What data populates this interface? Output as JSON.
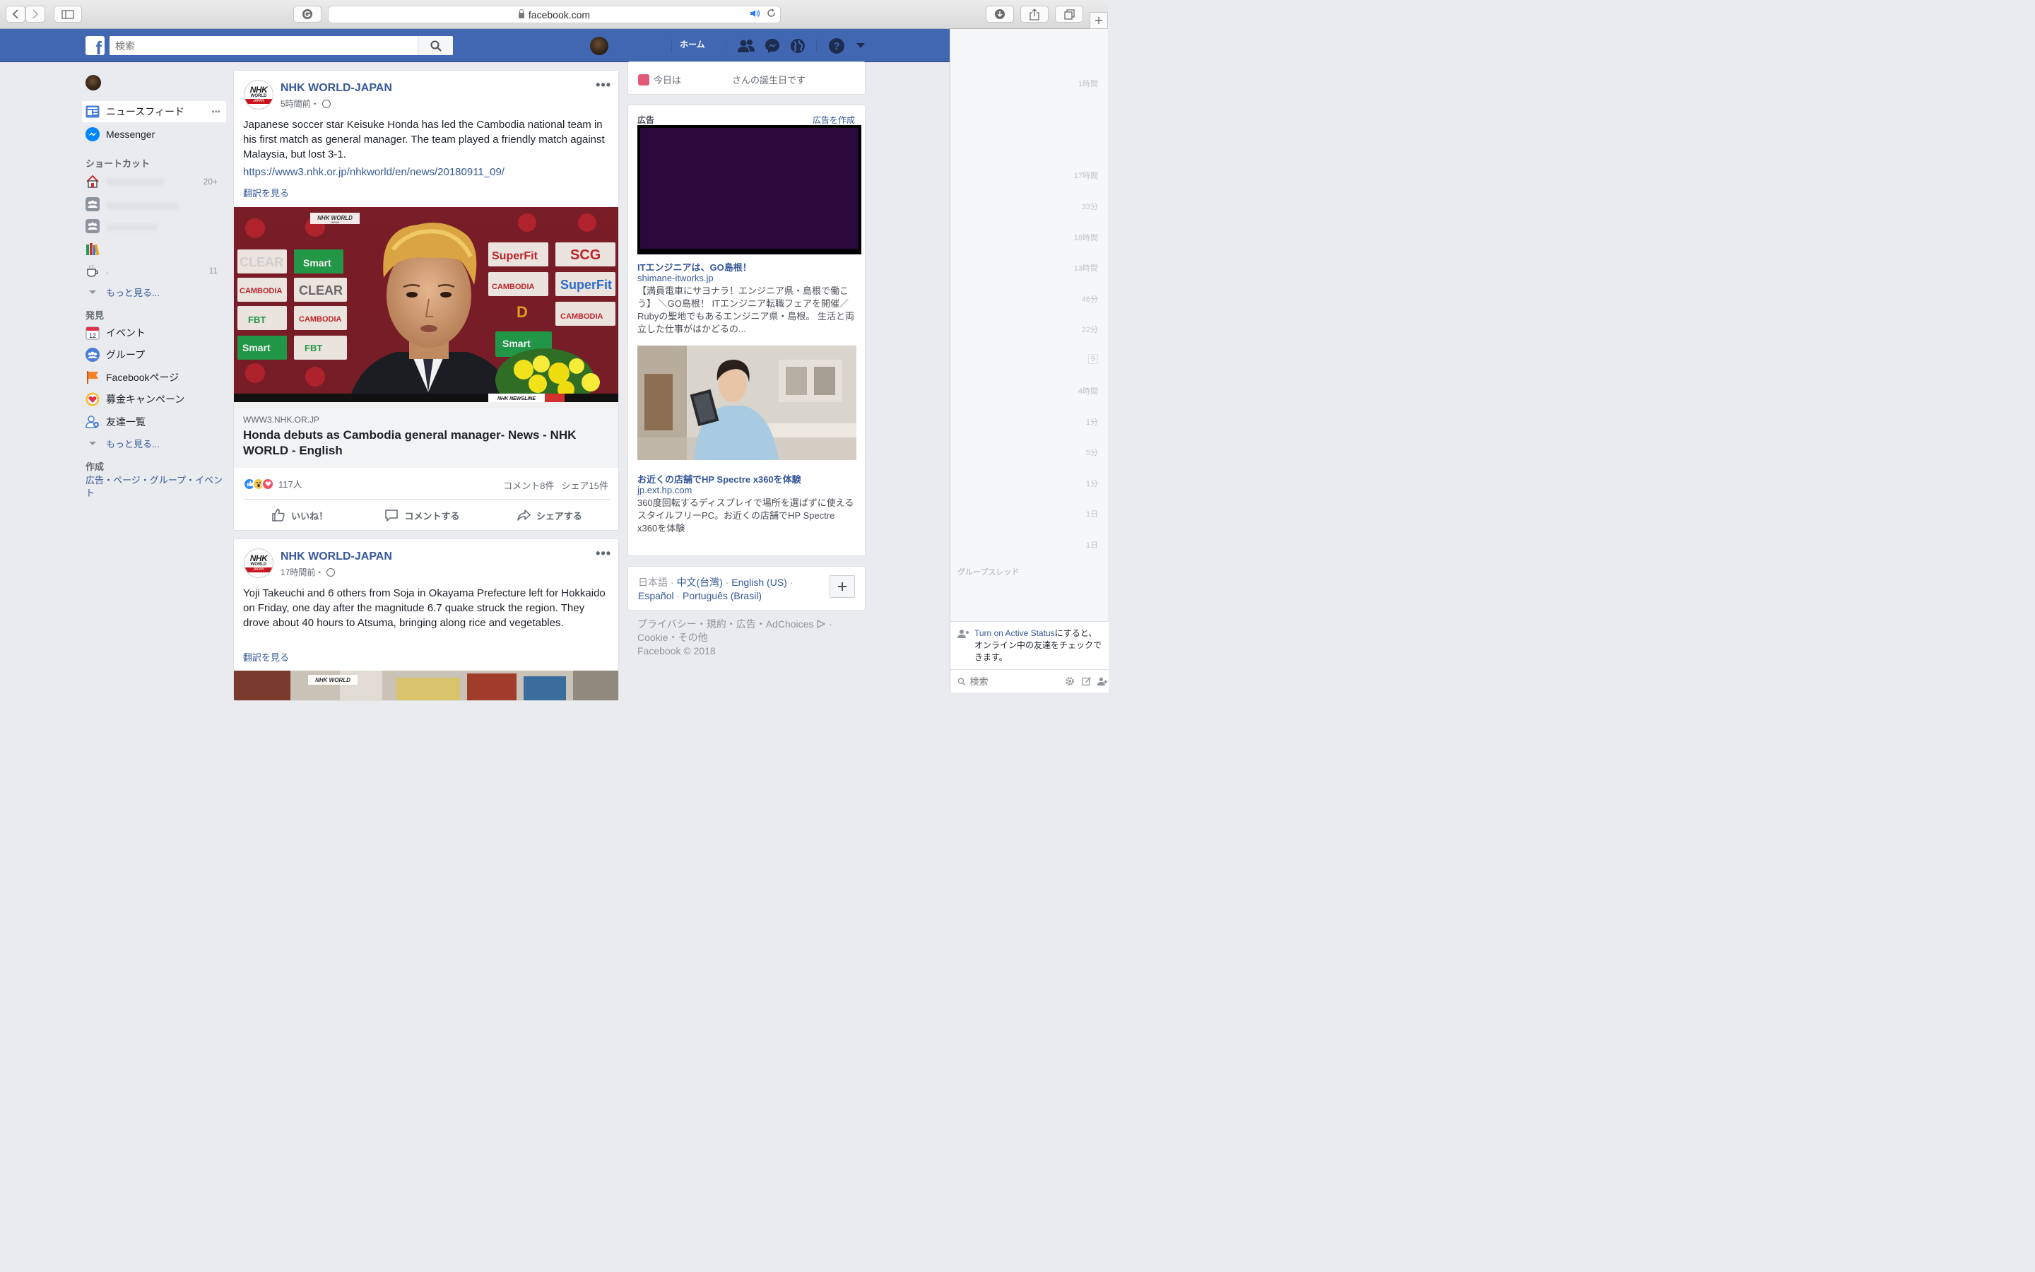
{
  "browser": {
    "url": "facebook.com"
  },
  "header": {
    "search_placeholder": "検索",
    "home_label": "ホーム"
  },
  "sidebar": {
    "news_feed": "ニュースフィード",
    "news_feed_more": "•••",
    "messenger": "Messenger",
    "shortcuts_title": "ショートカット",
    "shortcut_counts": [
      "20+",
      "11"
    ],
    "shortcut_dot": ".",
    "see_more_1": "もっと見る...",
    "explore_title": "発見",
    "explore_items": [
      "イベント",
      "グループ",
      "Facebookページ",
      "募金キャンペーン",
      "友達一覧"
    ],
    "calendar_day": "12",
    "see_more_2": "もっと見る...",
    "create_title": "作成",
    "create_links": "広告・ページ・グループ・イベント"
  },
  "posts": [
    {
      "page_name": "NHK WORLD-JAPAN",
      "time": "5時間前・",
      "text": "Japanese soccer star Keisuke Honda has led the Cambodia national team in his first match as general manager. The team played a friendly match against Malaysia, but lost 3-1.",
      "link": "https://www3.nhk.or.jp/nhkworld/en/news/20180911_09/",
      "translate": "翻訳を見る",
      "link_domain": "WWW3.NHK.OR.JP",
      "link_title": "Honda debuts as Cambodia general manager- News - NHK WORLD - English",
      "reactions_count": "117人",
      "comments": "コメント8件",
      "shares": "シェア15件",
      "actions": [
        "いいね！",
        "コメントする",
        "シェアする"
      ]
    },
    {
      "page_name": "NHK WORLD-JAPAN",
      "time": "17時間前・",
      "text": "Yoji Takeuchi and 6 others from Soja in Okayama Prefecture left for Hokkaido on Friday, one day after the magnitude 6.7 quake struck the region. They drove about 40 hours to Atsuma, bringing along rice and vegetables.",
      "translate": "翻訳を見る"
    }
  ],
  "photo_text": {
    "watermark": "NHK WORLD",
    "watermark_sub": "JAPAN",
    "ticker": "NHK NEWSLINE",
    "backdrop": [
      "CLEAR",
      "Smart",
      "SuperFit",
      "SCG",
      "CAMBODIA",
      "FBT",
      "D"
    ]
  },
  "page_avatar": {
    "line1": "NHK",
    "line2": "WORLD",
    "line3": "JAPAN"
  },
  "right": {
    "birthday_prefix": "今日は",
    "birthday_suffix": "さんの誕生日です",
    "ad_header": "広告",
    "ad_create": "広告を作成",
    "ads": [
      {
        "title": "ITエンジニアは、GO島根！",
        "url": "shimane-itworks.jp",
        "desc": "【満員電車にサヨナラ！エンジニア県・島根で働こう】 ＼GO島根！ ITエンジニア転職フェアを開催／ Rubyの聖地でもあるエンジニア県・島根。 生活と両立した仕事がはかどるの..."
      },
      {
        "title": "お近くの店舗でHP Spectre x360を体験",
        "url": "jp.ext.hp.com",
        "desc": "360度回転するディスプレイで場所を選ばずに使えるスタイルフリーPC。お近くの店舗でHP Spectre x360を体験"
      }
    ],
    "languages": {
      "current": "日本語",
      "others": [
        "中文(台灣)",
        "English (US)",
        "Español",
        "Português (Brasil)"
      ]
    },
    "footer_line1": "プライバシー・規約・広告・AdChoices",
    "footer_line2": "Cookie・その他",
    "copyright": "Facebook © 2018"
  },
  "chat": {
    "times": [
      "1時間",
      "17時間",
      "33分",
      "18時間",
      "13時間",
      "46分",
      "22分",
      "9",
      "4時間",
      "1分",
      "5分",
      "1分",
      "1日",
      "1日"
    ],
    "group_threads": "グループスレッド",
    "active_link": "Turn on Active Status",
    "active_rest": "にすると、オンライン中の友達をチェックできます。",
    "search_placeholder": "検索"
  },
  "colors": {
    "fb_blue": "#4267b2",
    "link": "#365899",
    "background": "#e9ebee"
  }
}
